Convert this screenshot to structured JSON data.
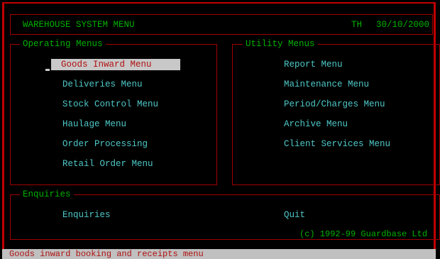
{
  "header": {
    "title": "WAREHOUSE SYSTEM MENU",
    "user": "TH",
    "date": "30/10/2000"
  },
  "operating": {
    "legend": "Operating Menus",
    "items": [
      "Goods Inward Menu",
      "Deliveries Menu",
      "Stock Control Menu",
      "Haulage Menu",
      "Order Processing",
      "Retail Order Menu"
    ]
  },
  "utility": {
    "legend": "Utility Menus",
    "items": [
      "Report Menu",
      "Maintenance Menu",
      "Period/Charges Menu",
      "Archive Menu",
      "Client Services Menu"
    ]
  },
  "enquiries": {
    "legend": "Enquiries",
    "enquiries_label": "Enquiries",
    "quit_label": "Quit"
  },
  "copyright": "(c) 1992-99 Guardbase Ltd",
  "status_text": "Goods inward booking and receipts menu",
  "colors": {
    "border": "#c00000",
    "title": "#00b000",
    "item": "#4fc8c8",
    "highlight_bg": "#c8c8c8",
    "highlight_fg": "#b01010"
  }
}
